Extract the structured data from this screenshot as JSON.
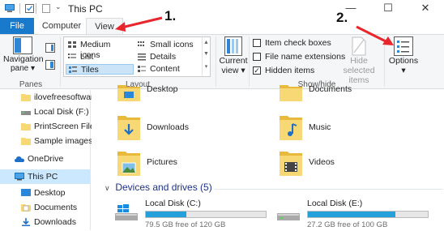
{
  "window": {
    "title": "This PC",
    "minimize_glyph": "—",
    "maximize_glyph": "☐",
    "close_glyph": "✕"
  },
  "tabs": [
    {
      "label": "File"
    },
    {
      "label": "Computer"
    },
    {
      "label": "View"
    }
  ],
  "ribbon": {
    "panes": {
      "nav_label_1": "Navigation",
      "nav_label_2": "pane",
      "group": "Panes"
    },
    "layout": {
      "items": [
        "Medium icons",
        "List",
        "Tiles",
        "Small icons",
        "Details",
        "Content"
      ],
      "selected": "Tiles",
      "group": "Layout"
    },
    "current_view": {
      "label_1": "Current",
      "label_2": "view"
    },
    "show_hide": {
      "checkboxes": [
        {
          "label": "Item check boxes",
          "checked": false
        },
        {
          "label": "File name extensions",
          "checked": false
        },
        {
          "label": "Hidden items",
          "checked": true
        }
      ],
      "hide_selected_1": "Hide selected",
      "hide_selected_2": "items",
      "group": "Show/hide"
    },
    "options": {
      "label": "Options"
    }
  },
  "annotations": {
    "step1": "1.",
    "step2": "2."
  },
  "nav": {
    "items": [
      {
        "label": "ilovefreesoftware"
      },
      {
        "label": "Local Disk (F:)"
      },
      {
        "label": "PrintScreen Files"
      },
      {
        "label": "Sample images"
      },
      {
        "label": "OneDrive"
      },
      {
        "label": "This PC"
      },
      {
        "label": "Desktop"
      },
      {
        "label": "Documents"
      },
      {
        "label": "Downloads"
      }
    ]
  },
  "folders": [
    {
      "label": "Desktop"
    },
    {
      "label": "Documents"
    },
    {
      "label": "Downloads"
    },
    {
      "label": "Music"
    },
    {
      "label": "Pictures"
    },
    {
      "label": "Videos"
    }
  ],
  "devices": {
    "heading": "Devices and drives (5)",
    "drives": [
      {
        "name": "Local Disk (C:)",
        "free": "79.5 GB free of 120 GB",
        "used_fraction": 0.34
      },
      {
        "name": "Local Disk (E:)",
        "free": "27.2 GB free of 100 GB",
        "used_fraction": 0.73
      }
    ]
  },
  "colors": {
    "accent": "#1979ca",
    "selection": "#cce8ff",
    "folder": "#f8d775",
    "drive_fill": "#26a0da",
    "annotation_arrow": "#e8262b"
  }
}
